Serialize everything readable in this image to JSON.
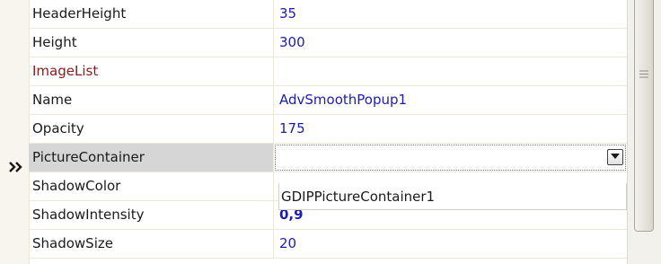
{
  "properties": [
    {
      "name": "HeaderHeight",
      "value": "35"
    },
    {
      "name": "Height",
      "value": "300"
    },
    {
      "name": "ImageList",
      "value": ""
    },
    {
      "name": "Name",
      "value": "AdvSmoothPopup1"
    },
    {
      "name": "Opacity",
      "value": "175"
    },
    {
      "name": "PictureContainer",
      "value": ""
    },
    {
      "name": "ShadowColor",
      "value": ""
    },
    {
      "name": "ShadowIntensity",
      "value": "0,9"
    },
    {
      "name": "ShadowSize",
      "value": "20"
    }
  ],
  "selected_property": "PictureContainer",
  "dropdown_option": "GDIPPictureContainer1",
  "colors": {
    "value_text": "#1d1dae",
    "reference_property_text": "#8b1a1a",
    "selected_row_background": "#d6d6d6",
    "gutter_background": "#f7f5ee"
  },
  "icons": {
    "row_selector": "double-chevron-right-icon",
    "dropdown": "dropdown-arrow-icon",
    "scroll_grip": "scrollbar-grip-icon"
  }
}
